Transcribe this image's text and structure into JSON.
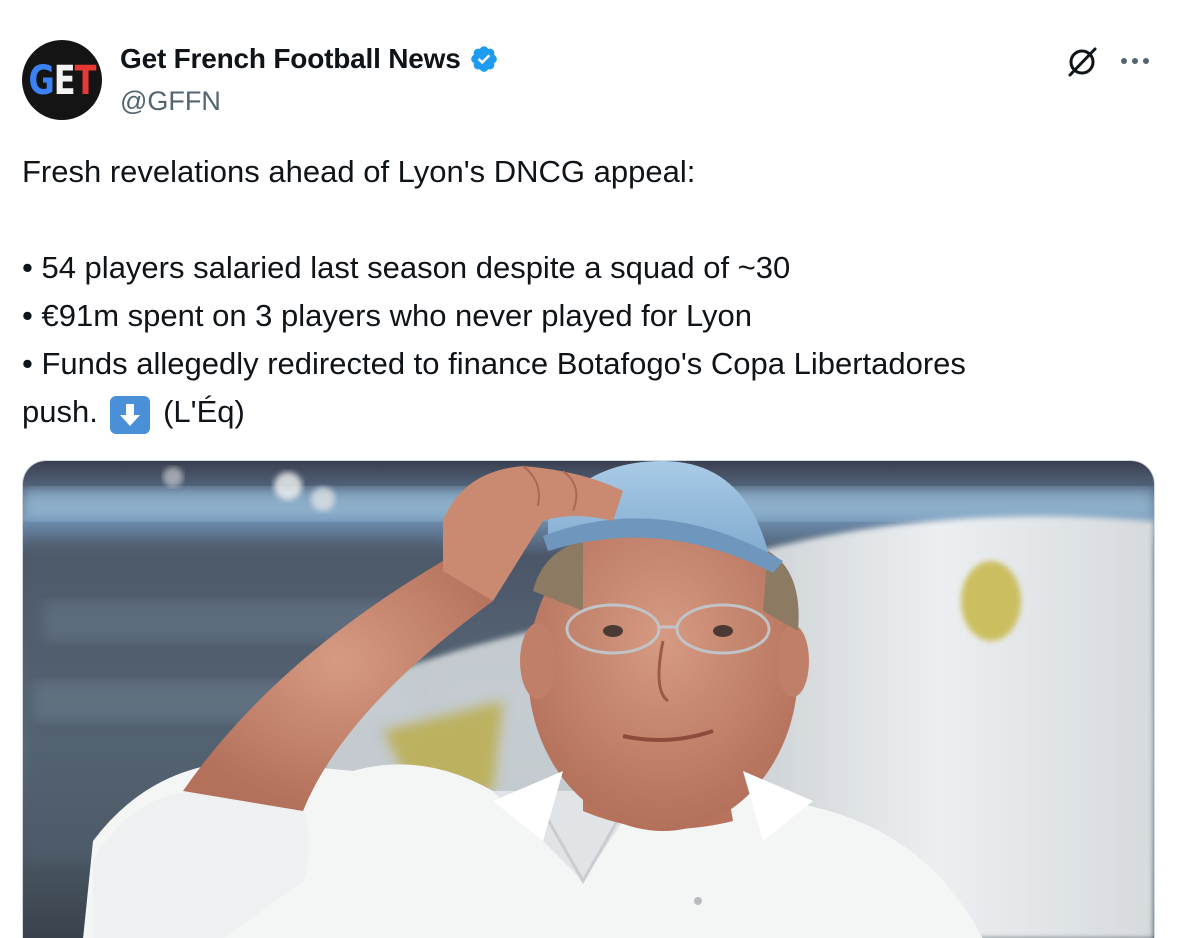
{
  "author": {
    "display_name": "Get French Football News",
    "handle": "@GFFN",
    "avatar_text": [
      "G",
      "E",
      "T"
    ],
    "verified": true,
    "verified_color": "#1d9bf0"
  },
  "actions": {
    "grok_icon": "grok-icon",
    "more_icon": "more-icon"
  },
  "tweet": {
    "line1": "Fresh revelations ahead of Lyon's DNCG appeal:",
    "bullet1": "• 54 players salaried last season despite a squad of ~30",
    "bullet2": "• €91m spent on 3 players who never played for Lyon",
    "bullet3": "• Funds allegedly redirected to finance Botafogo's Copa Libertadores",
    "bullet3_cont": "push.",
    "emoji": "down-arrow-emoji",
    "source": "(L'Éq)"
  },
  "media": {
    "type": "photo",
    "subject": "man in white shirt tipping light blue cap at stadium"
  },
  "colors": {
    "text": "#0f1419",
    "secondary": "#536471",
    "border": "#cfd9de",
    "emoji_bg": "#4a90d9"
  }
}
